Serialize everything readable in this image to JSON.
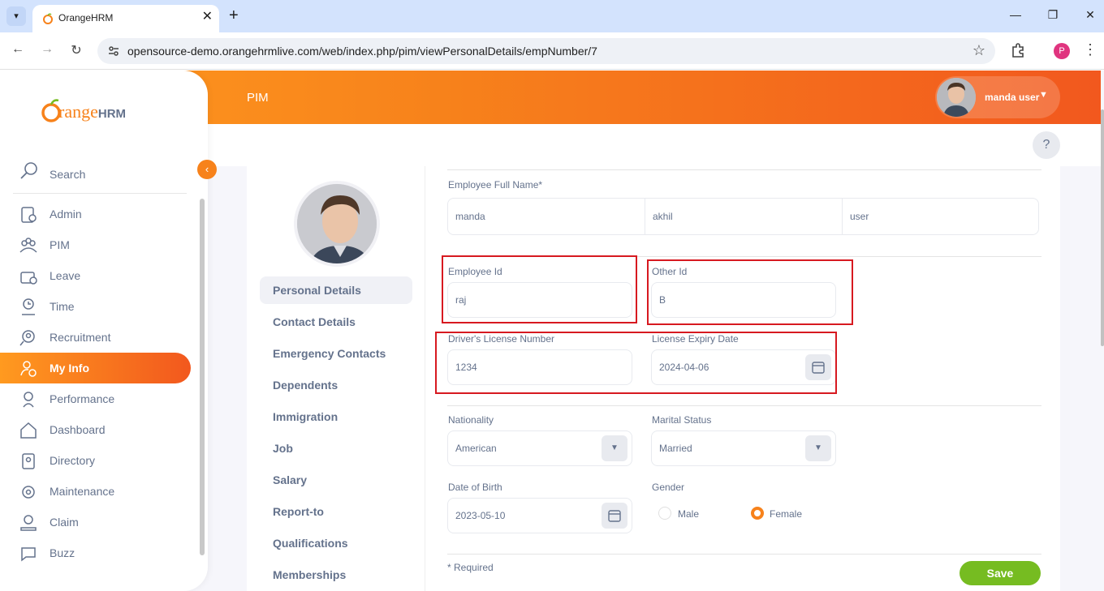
{
  "browser": {
    "tab_title": "OrangeHRM",
    "tab_close": "✕",
    "new_tab": "+",
    "url": "opensource-demo.orangehrmlive.com/web/index.php/pim/viewPersonalDetails/empNumber/7",
    "profile_initial": "P",
    "controls": {
      "minimize": "—",
      "restore": "❐",
      "close": "✕",
      "back": "←",
      "forward": "→",
      "reload": "↻",
      "star": "☆",
      "menu": "⋮",
      "tab_menu": "▾"
    }
  },
  "header": {
    "title": "PIM",
    "user_name": "manda user",
    "help": "?"
  },
  "sidebar": {
    "logo_main": "range",
    "logo_hrm": "HRM",
    "search_label": "Search",
    "collapse_icon": "‹",
    "items": [
      {
        "label": "Admin",
        "icon": "admin-icon"
      },
      {
        "label": "PIM",
        "icon": "pim-icon"
      },
      {
        "label": "Leave",
        "icon": "leave-icon"
      },
      {
        "label": "Time",
        "icon": "time-icon"
      },
      {
        "label": "Recruitment",
        "icon": "recruitment-icon"
      },
      {
        "label": "My Info",
        "icon": "my-info-icon",
        "active": true
      },
      {
        "label": "Performance",
        "icon": "performance-icon"
      },
      {
        "label": "Dashboard",
        "icon": "dashboard-icon"
      },
      {
        "label": "Directory",
        "icon": "directory-icon"
      },
      {
        "label": "Maintenance",
        "icon": "maintenance-icon"
      },
      {
        "label": "Claim",
        "icon": "claim-icon"
      },
      {
        "label": "Buzz",
        "icon": "buzz-icon"
      }
    ]
  },
  "profile_tabs": [
    "Personal Details",
    "Contact Details",
    "Emergency Contacts",
    "Dependents",
    "Immigration",
    "Job",
    "Salary",
    "Report-to",
    "Qualifications",
    "Memberships"
  ],
  "form": {
    "full_name_label": "Employee Full Name*",
    "first_name": "manda",
    "middle_name": "akhil",
    "last_name": "user",
    "employee_id_label": "Employee Id",
    "employee_id": "raj",
    "other_id_label": "Other Id",
    "other_id": "B",
    "license_label": "Driver's License Number",
    "license": "1234",
    "license_expiry_label": "License Expiry Date",
    "license_expiry": "2024-04-06",
    "nationality_label": "Nationality",
    "nationality": "American",
    "marital_label": "Marital Status",
    "marital": "Married",
    "dob_label": "Date of Birth",
    "dob": "2023-05-10",
    "gender_label": "Gender",
    "gender_male": "Male",
    "gender_female": "Female",
    "gender_selected": "Female",
    "required_note": "* Required",
    "save": "Save"
  },
  "colors": {
    "accent": "#f7821b",
    "save": "#76bc21",
    "highlight": "#d71920"
  }
}
